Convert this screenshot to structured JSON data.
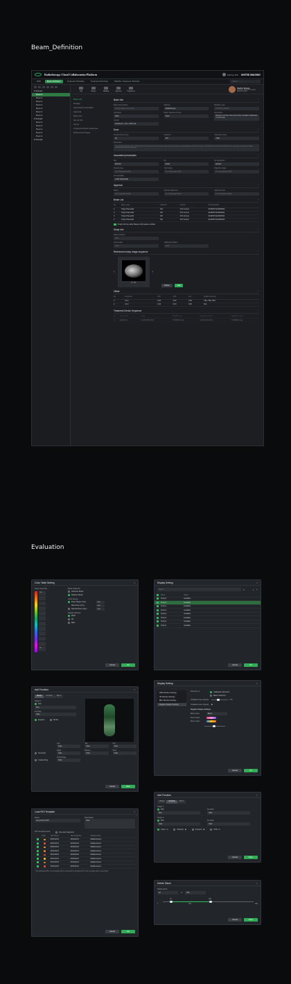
{
  "sections": {
    "beam": "Beam_Definition",
    "evaluation": "Evaluation"
  },
  "app": {
    "title": "Radiotherapy Cloud Collaboration Platform",
    "user": "Jiazhou WU",
    "brand": "UNITED IMAGING",
    "tabs": [
      "RHS",
      "Beam Definition",
      "Treatment Schedule",
      "Treatment Summary",
      "Machine Treatment Schedule"
    ],
    "search_placeholder": "Search...",
    "profile": {
      "name": "Sasha Terasa",
      "org": "Southern Medical Hospital",
      "role": "Radiotherapist"
    },
    "tree": [
      {
        "label": "Group1",
        "group": true
      },
      {
        "label": "Beam1",
        "sel": true
      },
      {
        "label": "Beam1"
      },
      {
        "label": "Beam1"
      },
      {
        "label": "Beam1"
      },
      {
        "label": "Beam1"
      },
      {
        "label": "Beam1"
      },
      {
        "label": "Beam1"
      },
      {
        "label": "Group2",
        "group": true
      },
      {
        "label": "Beam1"
      },
      {
        "label": "Beam1"
      },
      {
        "label": "Beam1"
      },
      {
        "label": "Beam1"
      },
      {
        "label": "Beam1"
      },
      {
        "label": "Group3",
        "group": true
      }
    ],
    "tools": [
      "Add",
      "Delete",
      "Validate",
      "Approve",
      "Unapprove"
    ],
    "side_nav": [
      "Basic Info",
      "Dosage",
      "Associated prescription",
      "Approval",
      "Beam List",
      "Set up Info",
      "Set up",
      "Treatment Device Sequence",
      "Referenced images"
    ]
  },
  "basic_info": {
    "title": "Basic Info",
    "fields": [
      {
        "label": "Beam Group Name",
        "value": "Group1 Plan test Ver100"
      },
      {
        "label": "Machine",
        "value": "Radiotherapy"
      },
      {
        "label": "Radiation type",
        "value": "PHOTON_BEAM"
      },
      {
        "label": "Technique",
        "value": "Hello"
      },
      {
        "label": "Beam Tolerance Preset",
        "value": "Hello"
      },
      {
        "label": "Description",
        "value": "Bedroom next blue finish point body modulation dashboard 3 mo/8 mode"
      },
      {
        "label": "Version",
        "value": "Treatment + IGI + CPIF G4"
      }
    ]
  },
  "dosage": {
    "title": "Dose",
    "fraction_dose_label": "Fraction Dose (cGy)",
    "fraction_dose": "20",
    "fraction_label": "Fractions",
    "fractions": "370",
    "total_label": "Total dose (cGy)",
    "total": "7400",
    "desc_label": "Description",
    "desc": "Curriculum for dosage was created based on the outcome of the pre-procedure treatment planning and dosimetry; selected fraction is calculated; the total dose distribution was reviewed and radio-oncologist confirmed the final set of beams."
  },
  "prescription": {
    "title": "Associated prescription",
    "fields": [
      {
        "label": "Site",
        "value": "Brainbtt"
      },
      {
        "label": "Rx",
        "value": "Radio"
      },
      {
        "label": "Rx description",
        "value": "Default"
      },
      {
        "label": "Fraction type",
        "value": "IS 1 Regulated 2000"
      },
      {
        "label": "Technology",
        "value": "IS 1 Regulated 2000"
      },
      {
        "label": "Objective target",
        "value": "IS 1 Regulated 2000"
      },
      {
        "label": "Accountability",
        "value": "CHAT REVISION"
      }
    ]
  },
  "approval": {
    "title": "Approval",
    "fields": [
      {
        "label": "Status",
        "value": "IS 1 Regulated 2000"
      },
      {
        "label": "Approval Date time",
        "value": "IS 1 Regulated 2000"
      },
      {
        "label": "Approved User",
        "value": "IS 1 Regulated 2000"
      }
    ]
  },
  "beam_list": {
    "title": "Beam List",
    "columns": [
      "No.",
      "Beam name",
      "XXXXXX",
      "XXXXX",
      "XXXXXXXXXX"
    ],
    "rows": [
      [
        "1",
        "Tokyo-Hanedahl",
        "NR",
        "270 min/Lar",
        "61066572223684304"
      ],
      [
        "2",
        "Tokyo-Hanedahl",
        "NR",
        "270 min/Lar",
        "61066572223684304"
      ],
      [
        "3",
        "Tokyo-Hanedahl",
        "NR",
        "270 min/Lar",
        "61066572223684304"
      ],
      [
        "4",
        "Tokyo-Hanedahl",
        "NR",
        "270 min/Lar",
        "61066572223684304"
      ]
    ],
    "check_label": "Check this box after Beams information verified"
  },
  "setup": {
    "title": "Setup Info",
    "fields": [
      {
        "label": "Patient Position",
        "value": "HFS"
      },
      {
        "label": "Setup Label",
        "value": "Hello"
      },
      {
        "label": "Additional Position",
        "value": "Hello"
      }
    ]
  },
  "ref_images": {
    "title": "Referenced setup image sequence",
    "caption": "CT 100",
    "btn_delete": "Delete",
    "btn_add": "Add"
  },
  "offset": {
    "title": "Offset",
    "columns": [
      "No.",
      "Increment",
      "VRT",
      "LNG",
      "LAT",
      "Relative Element"
    ],
    "rows": [
      [
        "1",
        "Art 1",
        "0.00",
        "0.00",
        "0.00",
        "TB1, TB2, TB3"
      ],
      [
        "2",
        "Art 2",
        "0.00",
        "0.00",
        "0.00",
        "Box"
      ]
    ]
  },
  "device_seq": {
    "title": "Treatment Device Sequence",
    "columns": [
      "No.",
      "Device Type",
      "Label",
      "Modality Type",
      "Wedge Accessory",
      "Applicator Code"
    ],
    "row": [
      "1",
      "Applicator",
      "Ins/Abs/Abs/Test",
      "0.00/Bolt/Lung",
      "Ins/Abs/Abs/Test",
      "0.00/Bolt/Lung"
    ]
  },
  "color_table": {
    "title": "Color Table Setting",
    "unit": "Dose Level (%)",
    "levels": [
      "102",
      "",
      "",
      "",
      "",
      "",
      "",
      "",
      "",
      "",
      "",
      "50"
    ],
    "mode_title": "Mode Selection",
    "modes": [
      "Absolute Mode",
      "Relative Mode"
    ],
    "unit_title": "Units setting",
    "units": [
      {
        "label": "Dose Target (cGy)",
        "value": "7000"
      },
      {
        "label": "Max Dose (cGy)",
        "value": "7000"
      },
      {
        "label": "Special Dose (cGy)",
        "value": "7000"
      }
    ],
    "display_title": "Display Window",
    "display": [
      "MPR",
      "3D",
      "BEV"
    ],
    "cancel": "Cancel",
    "ok": "OK"
  },
  "display_setting": {
    "title": "Display Setting",
    "search": "Search",
    "columns": [
      "Name",
      "Status"
    ],
    "rows": [
      {
        "name": "Script 1",
        "status": "Available"
      },
      {
        "name": "Script 1",
        "status": "Available",
        "sel": true
      },
      {
        "name": "Script 1",
        "status": "Available"
      },
      {
        "name": "Script 1",
        "status": "Available"
      },
      {
        "name": "Script 1",
        "status": "Available"
      },
      {
        "name": "Script 1",
        "status": "Available"
      },
      {
        "name": "Script 1",
        "status": "Available"
      },
      {
        "name": "Script 1",
        "status": "Available"
      }
    ],
    "cancel": "Cancel",
    "ok": "OK"
  },
  "add_function_big": {
    "title": "Add Function",
    "tabs": [
      "Margin",
      "Combine",
      "Mirror"
    ],
    "target_label": "Target 1",
    "radio": "ROI",
    "select1": "Skin",
    "sub_label": "Function",
    "select2": "Hello",
    "options": [
      "Expand",
      "Shrink"
    ],
    "grid": [
      {
        "label": "Left",
        "value": "Hello"
      },
      {
        "label": "Top",
        "value": "Hello"
      },
      {
        "label": "Ant",
        "value": "Hello"
      },
      {
        "label": "Right",
        "value": "Hello"
      },
      {
        "label": "Bottom",
        "value": "Hello"
      },
      {
        "label": "Post",
        "value": "Hello"
      }
    ],
    "chk1": "Overwrite",
    "chk2": "Create Ring",
    "tech_label": "Technology",
    "tech": "Hello",
    "cancel": "Cancel",
    "ok": "Save"
  },
  "display_setting2": {
    "title": "Display Setting",
    "menu": [
      "DRR Window Settings",
      "3D Window Settings",
      "BEV Window Settings",
      "Register Display Settings"
    ],
    "direction_label": "Direction to",
    "direction_opts": [
      "Calibration Direction",
      "Beam Direction"
    ],
    "opacity1_label": "Irradiated area Opacity",
    "opacity1": "170",
    "opacity2_label": "Irradiated area Opacity",
    "reg_title": "Register Display Settings",
    "blend_label": "Blend Area",
    "blend_value": "Blend",
    "fixed_label": "Fixed Color",
    "move_label": "Move Color",
    "cancel": "Cancel",
    "ok": "OK"
  },
  "load_roi": {
    "title": "Load ROI Template",
    "name_label": "Name",
    "name_value": "Lung Cancer ROI",
    "desc_label": "Description",
    "desc_value": "Hello",
    "section_label": "ROI Template Data",
    "use_seg": "Use Auto Segment",
    "columns": [
      "",
      "Color",
      "ROI Name",
      "Planning Role",
      "Biologic Role"
    ],
    "rows": [
      [
        "",
        "",
        "2019/10/01",
        "2019/02/01",
        "Matilda Evans"
      ],
      [
        "",
        "",
        "2019/10/01",
        "2019/02/01",
        "Matilda Evans"
      ],
      [
        "",
        "",
        "2019/10/01",
        "2019/02/01",
        "Matilda Evans"
      ],
      [
        "",
        "",
        "2019/10/01",
        "2019/02/01",
        "Matilda Evans"
      ],
      [
        "",
        "",
        "2019/10/01",
        "2019/02/01",
        "Matilda Evans"
      ],
      [
        "",
        "",
        "2019/10/01",
        "2019/02/01",
        "Matilda Evans"
      ],
      [
        "",
        "",
        "2019/10/01",
        "2019/02/01",
        "Matilda Evans"
      ],
      [
        "",
        "",
        "2019/10/01",
        "2019/02/01",
        "Matilda Evans"
      ]
    ],
    "note": "* The duplicate ROI in the template will be renamed/The duplicate ROI in the template will be overwritten",
    "cancel": "Cancel",
    "ok": "OK"
  },
  "add_function_small": {
    "title": "Add Function",
    "tabs": [
      "Margin",
      "Combine",
      "Mirror"
    ],
    "target1": "Target 1",
    "radio1": "ROI",
    "select1": "Skin",
    "func_label": "Function",
    "func1": "Hello",
    "target2": "Target 2",
    "radio2": "ROI",
    "select2": "Hello",
    "func2": "Hello",
    "ops": [
      "Union",
      "Subtract",
      "Intersect",
      "XOR"
    ],
    "cancel": "Cancel",
    "ok": "Save"
  },
  "delete_slices": {
    "title": "Delete Slices",
    "range_label": "Delete slices",
    "from": "20",
    "to_label": "to",
    "to": "200",
    "ticks": [
      "1",
      "20",
      "100",
      "200",
      "255"
    ],
    "cancel": "Cancel",
    "ok": "Save"
  }
}
